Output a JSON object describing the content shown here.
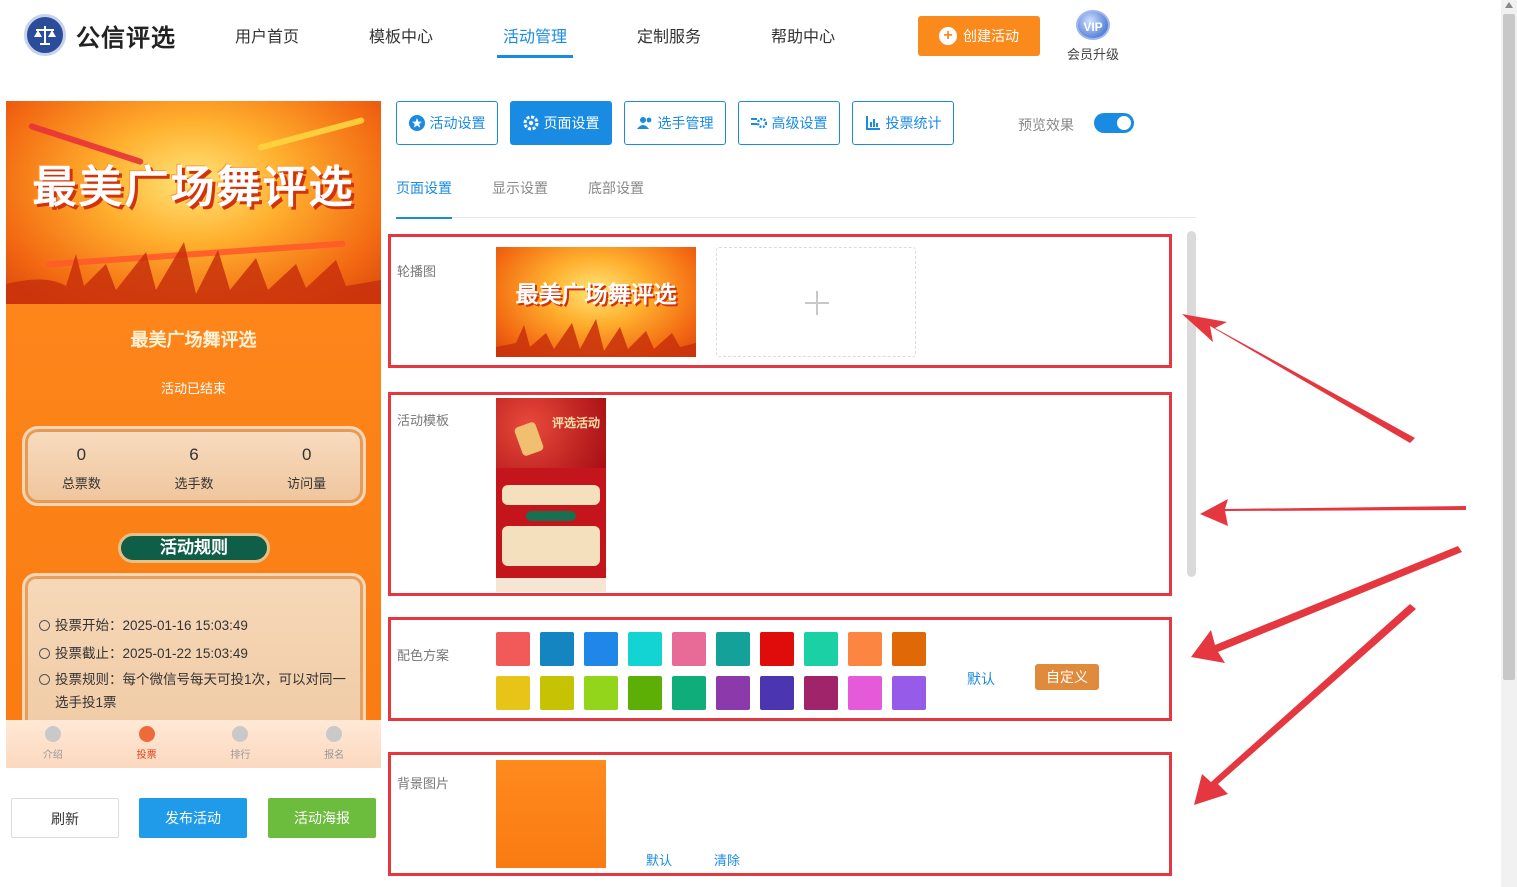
{
  "header": {
    "logo_text": "公信评选",
    "nav": [
      {
        "label": "用户首页"
      },
      {
        "label": "模板中心"
      },
      {
        "label": "活动管理",
        "active": true
      },
      {
        "label": "定制服务"
      },
      {
        "label": "帮助中心"
      }
    ],
    "create_button": "创建活动",
    "vip_badge": "VIP",
    "vip_label": "会员升级"
  },
  "phone": {
    "banner_title": "最美广场舞评选",
    "title": "最美广场舞评选",
    "status": "活动已结束",
    "stats": [
      {
        "value": "0",
        "label": "总票数"
      },
      {
        "value": "6",
        "label": "选手数"
      },
      {
        "value": "0",
        "label": "访问量"
      }
    ],
    "rules_title": "活动规则",
    "rules": [
      "投票开始：2025-01-16 15:03:49",
      "投票截止：2025-01-22 15:03:49",
      "投票规则：每个微信号每天可投1次，可以对同一选手投1票"
    ],
    "tabs": [
      {
        "label": "介绍"
      },
      {
        "label": "投票",
        "active": true
      },
      {
        "label": "排行"
      },
      {
        "label": "报名"
      }
    ]
  },
  "left_buttons": {
    "refresh": "刷新",
    "publish": "发布活动",
    "poster": "活动海报"
  },
  "toolbar": {
    "buttons": [
      {
        "label": "活动设置",
        "icon": "star-icon"
      },
      {
        "label": "页面设置",
        "icon": "gear-icon",
        "active": true
      },
      {
        "label": "选手管理",
        "icon": "users-icon"
      },
      {
        "label": "高级设置",
        "icon": "gears-icon"
      },
      {
        "label": "投票统计",
        "icon": "bar-chart-icon"
      }
    ],
    "preview_label": "预览效果",
    "preview_on": true
  },
  "subtabs": [
    {
      "label": "页面设置",
      "active": true
    },
    {
      "label": "显示设置"
    },
    {
      "label": "底部设置"
    }
  ],
  "sections": {
    "carousel": {
      "label": "轮播图",
      "thumb_title": "最美广场舞评选"
    },
    "template": {
      "label": "活动模板",
      "thumb_title": "评选活动"
    },
    "colors": {
      "label": "配色方案",
      "swatches": [
        "#f25a5a",
        "#1485c0",
        "#1f87e8",
        "#14d3d3",
        "#e86a96",
        "#14a19a",
        "#e00c0c",
        "#19d1a5",
        "#fc8541",
        "#e06807",
        "#e8c418",
        "#c5c303",
        "#92d51b",
        "#5daf06",
        "#0fad7a",
        "#8c39ab",
        "#4c35b0",
        "#a02469",
        "#e45ad9",
        "#965ce9"
      ],
      "default_link": "默认",
      "custom_button": "自定义",
      "accent": "#e08a3c"
    },
    "background": {
      "label": "背景图片",
      "default_link": "默认",
      "clear_link": "清除"
    }
  }
}
